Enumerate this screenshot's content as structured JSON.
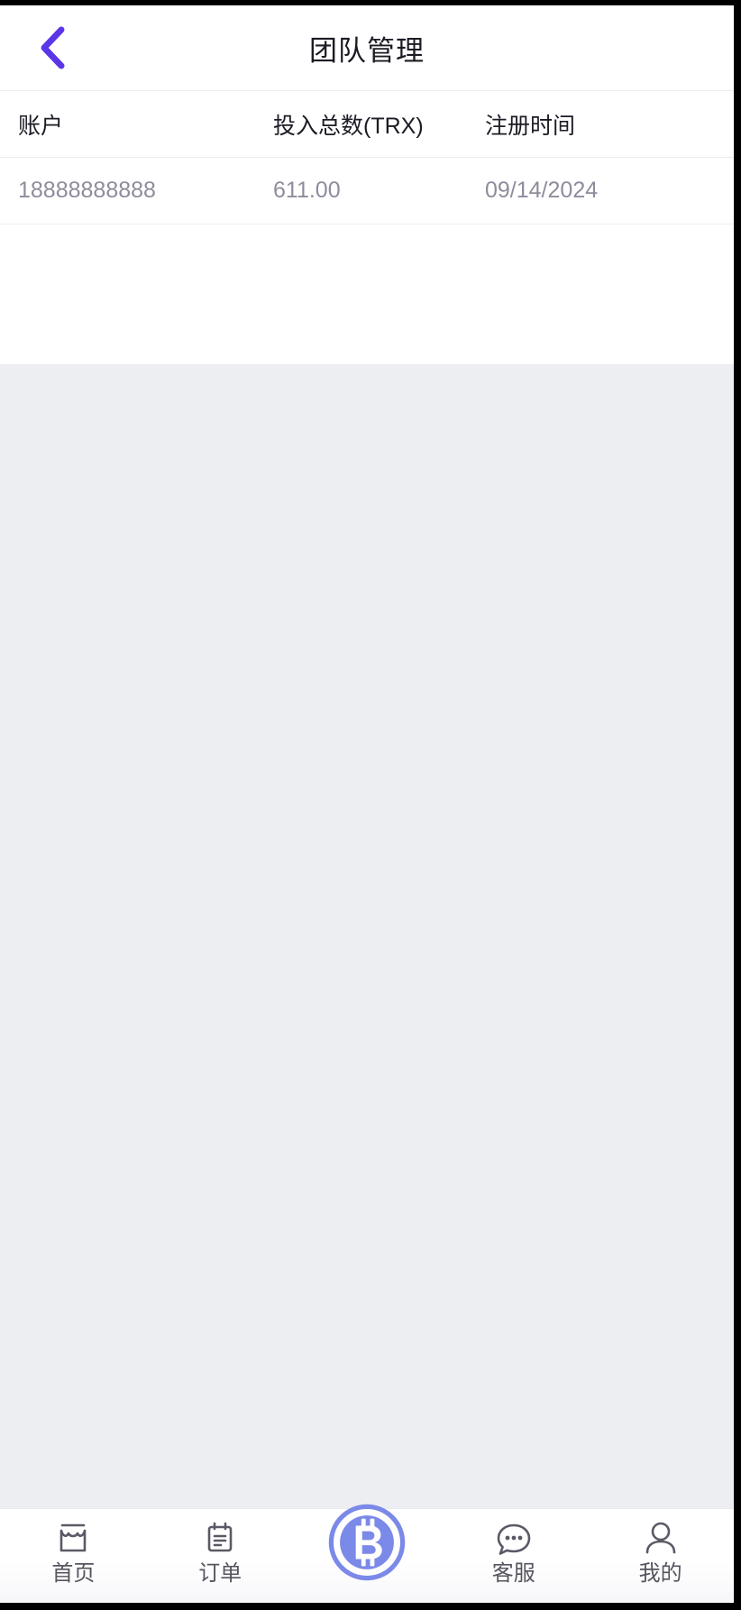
{
  "header": {
    "title": "团队管理",
    "back_icon": "chevron-left-icon",
    "back_color": "#5a36e8"
  },
  "table": {
    "columns": [
      "账户",
      "投入总数(TRX)",
      "注册时间"
    ],
    "rows": [
      {
        "account": "18888888888",
        "total_invested": "611.00",
        "register_time": "09/14/2024"
      }
    ]
  },
  "tabbar": {
    "items": [
      {
        "label": "首页",
        "icon": "storefront-icon",
        "active": false
      },
      {
        "label": "订单",
        "icon": "clipboard-icon",
        "active": false
      },
      {
        "label": "",
        "icon": "bitcoin-icon",
        "active": true
      },
      {
        "label": "客服",
        "icon": "chat-bubble-icon",
        "active": false
      },
      {
        "label": "我的",
        "icon": "person-icon",
        "active": false
      }
    ],
    "accent_color": "#7b89e8",
    "label_color": "#55555f"
  }
}
